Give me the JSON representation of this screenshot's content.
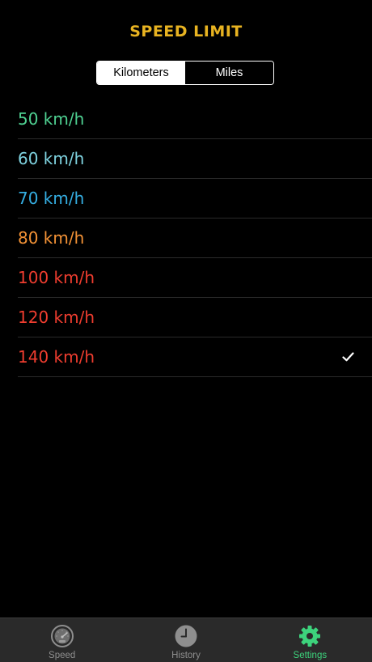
{
  "header": {
    "title": "SPEED LIMIT",
    "title_color": "#e8b321"
  },
  "unit_toggle": {
    "options": [
      "Kilometers",
      "Miles"
    ],
    "selected": "Kilometers"
  },
  "speed_options": [
    {
      "label": "50 km/h",
      "color": "#4fd192",
      "selected": false
    },
    {
      "label": "60 km/h",
      "color": "#7fd3e0",
      "selected": false
    },
    {
      "label": "70 km/h",
      "color": "#35aee2",
      "selected": false
    },
    {
      "label": "80 km/h",
      "color": "#f39236",
      "selected": false
    },
    {
      "label": "100 km/h",
      "color": "#ef3d2f",
      "selected": false
    },
    {
      "label": "120 km/h",
      "color": "#ef3d2f",
      "selected": false
    },
    {
      "label": "140 km/h",
      "color": "#ef3d2f",
      "selected": true
    }
  ],
  "selected_icon": "checkmark-icon",
  "tabbar": {
    "tabs": [
      {
        "label": "Speed",
        "icon": "speedometer-icon",
        "active": false
      },
      {
        "label": "History",
        "icon": "clock-icon",
        "active": false
      },
      {
        "label": "Settings",
        "icon": "gear-icon",
        "active": true
      }
    ],
    "active_color": "#3dd37c",
    "inactive_color": "#8e8e8e"
  }
}
